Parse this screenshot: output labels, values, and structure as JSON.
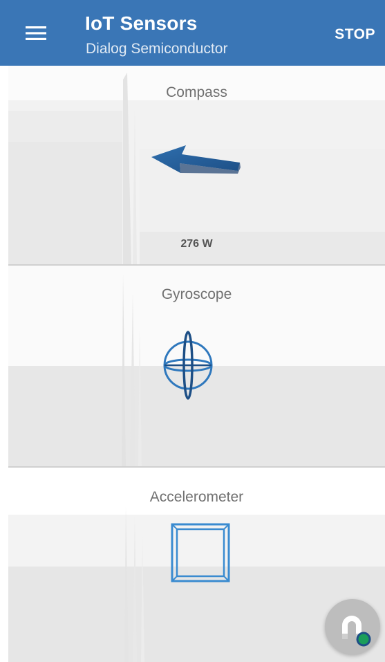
{
  "toolbar": {
    "title": "IoT Sensors",
    "subtitle": "Dialog Semiconductor",
    "stop_label": "STOP",
    "menu_icon": "hamburger-menu-icon",
    "background_color": "#3a76b6"
  },
  "sensors": {
    "compass": {
      "label": "Compass",
      "value": "276 W",
      "icon": "compass-arrow-icon"
    },
    "gyroscope": {
      "label": "Gyroscope",
      "icon": "gyroscope-sphere-icon"
    },
    "accelerometer": {
      "label": "Accelerometer",
      "icon": "accelerometer-cube-icon"
    }
  },
  "fab": {
    "icon": "magnet-icon",
    "status_color": "#1a9e5a"
  }
}
